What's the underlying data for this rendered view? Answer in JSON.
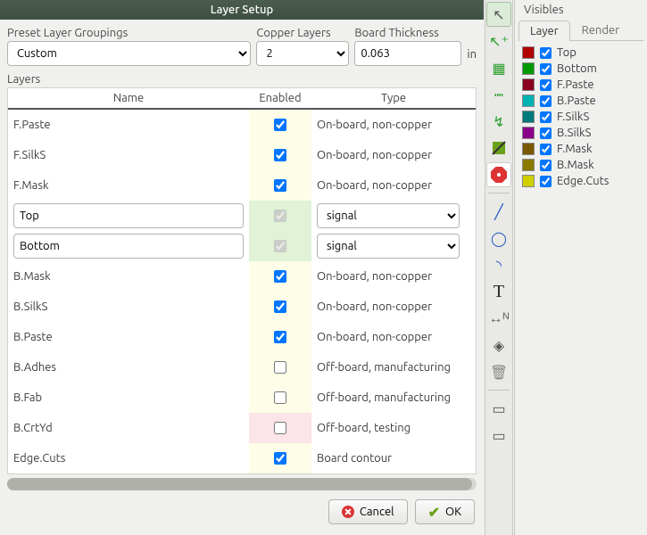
{
  "dialog": {
    "title": "Layer Setup",
    "preset_label": "Preset Layer Groupings",
    "preset_value": "Custom",
    "copper_label": "Copper Layers",
    "copper_value": "2",
    "thickness_label": "Board Thickness",
    "thickness_value": "0.063",
    "thickness_unit": "in",
    "layers_label": "Layers",
    "headers": {
      "name": "Name",
      "enabled": "Enabled",
      "type": "Type"
    },
    "cancel": "Cancel",
    "ok": "OK"
  },
  "rows": [
    {
      "name": "F.Paste",
      "editable": false,
      "enabled": true,
      "bg": "yel",
      "type_text": "On-board, non-copper"
    },
    {
      "name": "F.SilkS",
      "editable": false,
      "enabled": true,
      "bg": "yel",
      "type_text": "On-board, non-copper"
    },
    {
      "name": "F.Mask",
      "editable": false,
      "enabled": true,
      "bg": "yel",
      "type_text": "On-board, non-copper"
    },
    {
      "name": "Top",
      "editable": true,
      "enabled": true,
      "bg": "green",
      "type_select": "signal"
    },
    {
      "name": "Bottom",
      "editable": true,
      "enabled": true,
      "bg": "green",
      "type_select": "signal"
    },
    {
      "name": "B.Mask",
      "editable": false,
      "enabled": true,
      "bg": "yel",
      "type_text": "On-board, non-copper"
    },
    {
      "name": "B.SilkS",
      "editable": false,
      "enabled": true,
      "bg": "yel",
      "type_text": "On-board, non-copper"
    },
    {
      "name": "B.Paste",
      "editable": false,
      "enabled": true,
      "bg": "yel",
      "type_text": "On-board, non-copper"
    },
    {
      "name": "B.Adhes",
      "editable": false,
      "enabled": false,
      "bg": "yel",
      "type_text": "Off-board, manufacturing"
    },
    {
      "name": "B.Fab",
      "editable": false,
      "enabled": false,
      "bg": "yel",
      "type_text": "Off-board, manufacturing"
    },
    {
      "name": "B.CrtYd",
      "editable": false,
      "enabled": false,
      "bg": "pink",
      "type_text": "Off-board, testing"
    },
    {
      "name": "Edge.Cuts",
      "editable": false,
      "enabled": true,
      "bg": "yel",
      "type_text": "Board contour"
    }
  ],
  "visibles": {
    "title": "Visibles",
    "tabs": {
      "layer": "Layer",
      "render": "Render"
    },
    "items": [
      {
        "name": "Top",
        "color": "#b00000",
        "checked": true
      },
      {
        "name": "Bottom",
        "color": "#009a00",
        "checked": true
      },
      {
        "name": "F.Paste",
        "color": "#8a0020",
        "checked": true
      },
      {
        "name": "B.Paste",
        "color": "#00b3b3",
        "checked": true
      },
      {
        "name": "F.SilkS",
        "color": "#007a7a",
        "checked": true
      },
      {
        "name": "B.SilkS",
        "color": "#8a008a",
        "checked": true
      },
      {
        "name": "F.Mask",
        "color": "#7a5a00",
        "checked": true
      },
      {
        "name": "B.Mask",
        "color": "#8a7a00",
        "checked": true
      },
      {
        "name": "Edge.Cuts",
        "color": "#cfcf00",
        "checked": true
      }
    ]
  },
  "toolbar_icons": [
    "cursor",
    "cursor-add",
    "grid",
    "dashline",
    "curve",
    "route",
    "net",
    "arc",
    "arc2",
    "text",
    "dimension",
    "target",
    "trash",
    "tool-a",
    "tool-b"
  ]
}
